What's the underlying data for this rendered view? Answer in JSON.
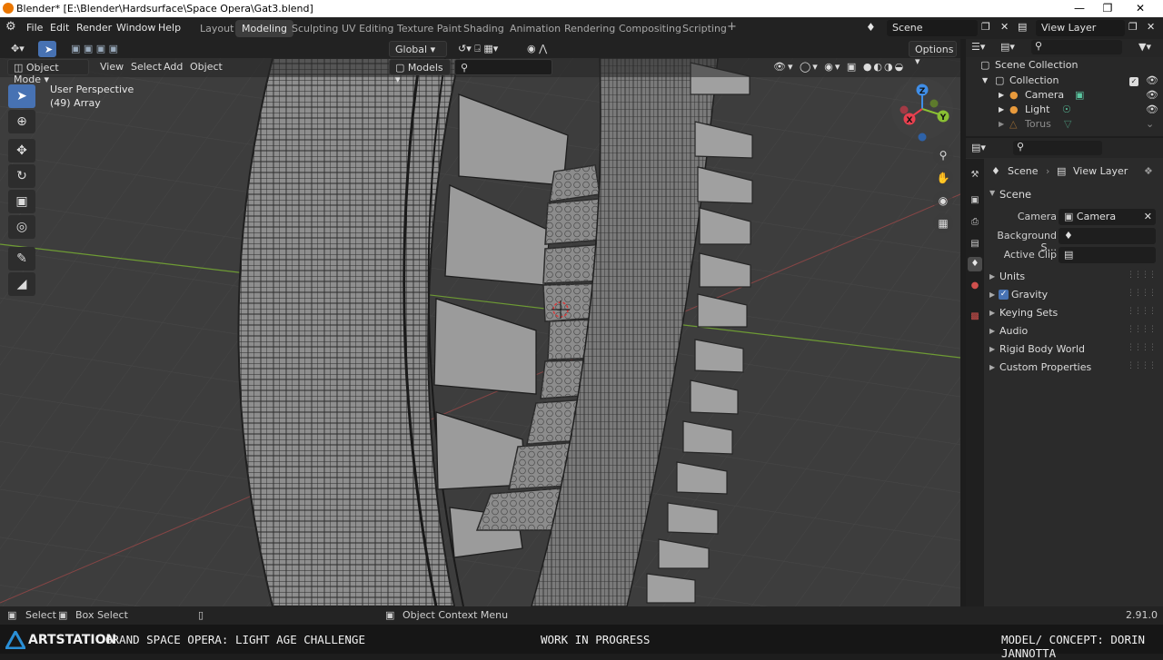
{
  "window": {
    "title": "Blender* [E:\\Blender\\Hardsurface\\Space Opera\\Gat3.blend]"
  },
  "menus": [
    "File",
    "Edit",
    "Render",
    "Window",
    "Help"
  ],
  "workspaces": [
    "Layout",
    "Modeling",
    "Sculpting",
    "UV Editing",
    "Texture Paint",
    "Shading",
    "Animation",
    "Rendering",
    "Compositing",
    "Scripting"
  ],
  "active_workspace": "Modeling",
  "scene_field": "Scene",
  "view_layer_field": "View Layer",
  "viewport_header": {
    "mode": "Object Mode",
    "menus": [
      "View",
      "Select",
      "Add",
      "Object"
    ],
    "orientation": "Global",
    "collection": "Models",
    "options": "Options"
  },
  "viewport": {
    "perspective": "User Perspective",
    "object_info": "(49) Array",
    "gizmo": {
      "x": "X",
      "y": "Y",
      "z": "Z"
    }
  },
  "outliner": {
    "root": "Scene Collection",
    "items": [
      {
        "label": "Collection"
      },
      {
        "label": "Camera"
      },
      {
        "label": "Light"
      },
      {
        "label": "Torus"
      }
    ]
  },
  "properties": {
    "breadcrumb_scene": "Scene",
    "breadcrumb_view_layer": "View Layer",
    "section": "Scene",
    "camera_label": "Camera",
    "camera_value": "Camera",
    "background_label": "Background S...",
    "active_clip_label": "Active Clip",
    "panels": [
      "Units",
      "Gravity",
      "Keying Sets",
      "Audio",
      "Rigid Body World",
      "Custom Properties"
    ]
  },
  "statusbar": {
    "select": "Select",
    "box_select": "Box Select",
    "context_menu": "Object Context Menu",
    "version": "2.91.0"
  },
  "banner": {
    "logo": "ARTSTATION",
    "challenge": "GRAND SPACE OPERA: LIGHT AGE CHALLENGE",
    "status": "WORK IN PROGRESS",
    "credit": "MODEL/ CONCEPT: DORIN JANNOTTA"
  },
  "colors": {
    "accent": "#4772b3",
    "x_axis": "#e8404f",
    "y_axis": "#8ac033",
    "z_axis": "#3f8ee8"
  }
}
